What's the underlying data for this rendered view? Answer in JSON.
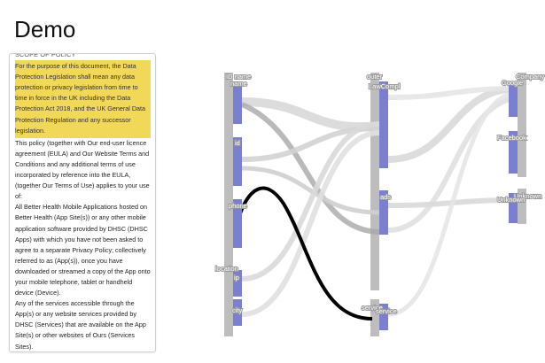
{
  "page": {
    "title": "Demo"
  },
  "policy": {
    "heading": "SCOPE OF POLICY",
    "highlighted": "For the purpose of this document, the Data Protection Legislation shall mean any data protection or privacy legislation from time to time in force in the UK including the Data Protection Act 2018, and the UK General Data Protection Regulation and any successor legislation.",
    "paragraphs": [
      "This policy (together with Our end-user licence agreement (EULA) and Our Website Terms and Conditions and any additional terms of use incorporated by reference into the EULA, (together Our Terms of Use) applies to your use of:",
      "All Better Health Mobile Applications hosted on Better Health (App Site(s)) or any other mobile application software provided by DHSC (DHSC Apps) with which you have not been asked to agree to a separate Privacy Policy; collectively referred to as (App(s)), once you have downloaded or streamed a copy of the App onto your mobile telephone, tablet or handheld device (Device).",
      "Any of the services accessible through the App(s) or any website services provided by DHSC (Services) that are available on the App Site(s) or other websites of Ours (Services Sites)."
    ]
  },
  "flow": {
    "columns": [
      {
        "id": "col1",
        "label": "ID name"
      },
      {
        "id": "col2",
        "label": "outer"
      },
      {
        "id": "col3",
        "label": "Company"
      }
    ],
    "groups": [
      {
        "id": "g_idname",
        "label": "ID name"
      },
      {
        "id": "g_location",
        "label": "location"
      },
      {
        "id": "g_outer",
        "label": "outer"
      },
      {
        "id": "g_service",
        "label": "service"
      },
      {
        "id": "g_company",
        "label": "Company"
      },
      {
        "id": "g_unknown",
        "label": "Unknown"
      }
    ],
    "nodes": [
      {
        "id": "name",
        "label": "name"
      },
      {
        "id": "id",
        "label": "id"
      },
      {
        "id": "phone",
        "label": "phone"
      },
      {
        "id": "ip",
        "label": "ip"
      },
      {
        "id": "city",
        "label": "city"
      },
      {
        "id": "lawcompl",
        "label": "LawCompl"
      },
      {
        "id": "ads",
        "label": "ads"
      },
      {
        "id": "service",
        "label": "service"
      },
      {
        "id": "google",
        "label": "Google"
      },
      {
        "id": "facebook",
        "label": "Facebook"
      },
      {
        "id": "unknown",
        "label": "Unknown"
      }
    ],
    "colors": {
      "column_bar": "#bdbdbd",
      "node_fill": "#7b7fd0",
      "link": "#d3d3d3",
      "link_mid": "#a8a8a8",
      "link_dark": "#8a8a8a",
      "highlight_link": "#000000",
      "highlight_text": "#f2d858"
    }
  }
}
